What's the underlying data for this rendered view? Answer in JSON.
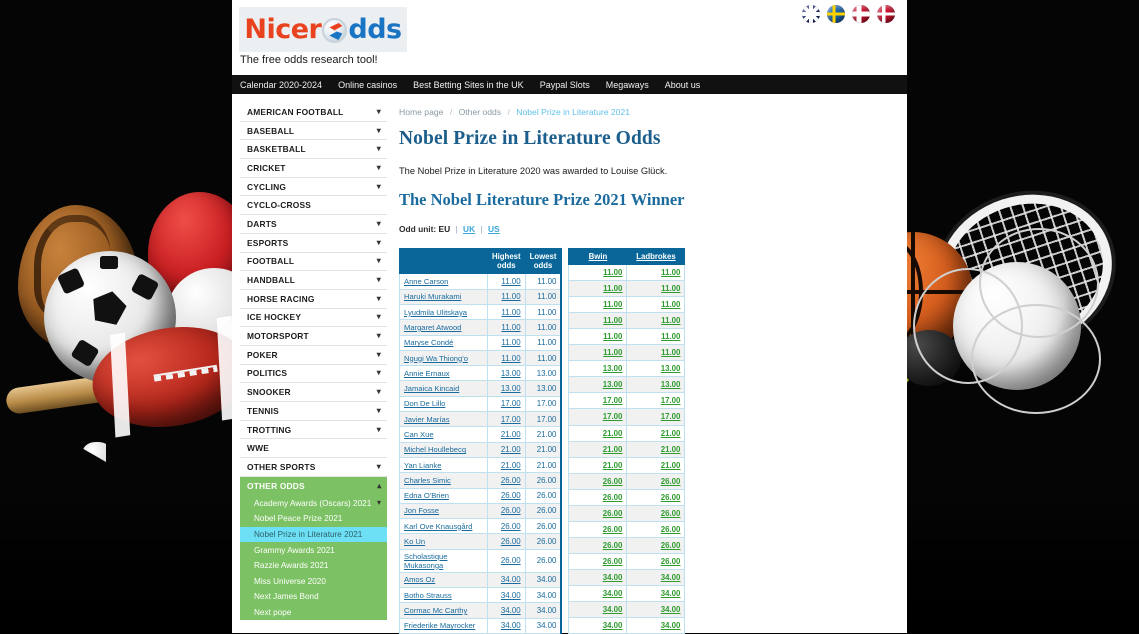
{
  "site": {
    "logo_nicer": "Nicer",
    "logo_dds": "dds",
    "tagline": "The free odds research tool!"
  },
  "flags": [
    {
      "name": "flag-uk",
      "label": "United Kingdom"
    },
    {
      "name": "flag-se",
      "label": "Sweden"
    },
    {
      "name": "flag-no",
      "label": "Norway"
    },
    {
      "name": "flag-dk",
      "label": "Denmark"
    }
  ],
  "topnav": [
    {
      "label": "Calendar 2020-2024"
    },
    {
      "label": "Online casinos"
    },
    {
      "label": "Best Betting Sites in the UK"
    },
    {
      "label": "Paypal Slots"
    },
    {
      "label": "Megaways"
    },
    {
      "label": "About us"
    }
  ],
  "sidebar": {
    "sports": [
      {
        "label": "AMERICAN FOOTBALL",
        "chevron": true
      },
      {
        "label": "BASEBALL",
        "chevron": true
      },
      {
        "label": "BASKETBALL",
        "chevron": true
      },
      {
        "label": "CRICKET",
        "chevron": true
      },
      {
        "label": "CYCLING",
        "chevron": true
      },
      {
        "label": "CYCLO-CROSS",
        "chevron": false
      },
      {
        "label": "DARTS",
        "chevron": true
      },
      {
        "label": "ESPORTS",
        "chevron": true
      },
      {
        "label": "FOOTBALL",
        "chevron": true
      },
      {
        "label": "HANDBALL",
        "chevron": true
      },
      {
        "label": "HORSE RACING",
        "chevron": true
      },
      {
        "label": "ICE HOCKEY",
        "chevron": true
      },
      {
        "label": "MOTORSPORT",
        "chevron": true
      },
      {
        "label": "POKER",
        "chevron": true
      },
      {
        "label": "POLITICS",
        "chevron": true
      },
      {
        "label": "SNOOKER",
        "chevron": true
      },
      {
        "label": "TENNIS",
        "chevron": true
      },
      {
        "label": "TROTTING",
        "chevron": true
      },
      {
        "label": "WWE",
        "chevron": false
      },
      {
        "label": "OTHER SPORTS",
        "chevron": true
      }
    ],
    "other_odds": {
      "header": "OTHER ODDS",
      "expanded": true,
      "items": [
        {
          "label": "Academy Awards (Oscars) 2021",
          "chevron": true,
          "active": false
        },
        {
          "label": "Nobel Peace Prize 2021",
          "chevron": false,
          "active": false
        },
        {
          "label": "Nobel Prize in Literature 2021",
          "chevron": false,
          "active": true
        },
        {
          "label": "Grammy Awards 2021",
          "chevron": false,
          "active": false
        },
        {
          "label": "Razzie Awards 2021",
          "chevron": false,
          "active": false
        },
        {
          "label": "Miss Universe 2020",
          "chevron": false,
          "active": false
        },
        {
          "label": "Next James Bond",
          "chevron": false,
          "active": false
        },
        {
          "label": "Next pope",
          "chevron": false,
          "active": false
        }
      ]
    },
    "colors": {
      "green": "#7cc163",
      "active_highlight": "#6de0f5"
    }
  },
  "content": {
    "breadcrumb": [
      {
        "label": "Home page",
        "current": false
      },
      {
        "label": "Other odds",
        "current": false
      },
      {
        "label": "Nobel Prize in Literature 2021",
        "current": true
      }
    ],
    "breadcrumb_separator": "/",
    "page_title": "Nobel Prize in Literature Odds",
    "intro_text": "The Nobel Prize in Literature 2020 was awarded to Louise Glück.",
    "section_title": "The Nobel Literature Prize 2021 Winner",
    "odd_unit": {
      "label": "Odd unit:",
      "current": "EU",
      "options": [
        "EU",
        "UK",
        "US"
      ],
      "links": [
        "UK",
        "US"
      ],
      "separator": "|"
    },
    "table": {
      "headers": {
        "name": "",
        "highest": "Highest odds",
        "lowest": "Lowest odds"
      },
      "bookmakers": [
        "Bwin",
        "Ladbrokes"
      ],
      "rows": [
        {
          "name": "Anne Carson",
          "highest": "11.00",
          "lowest": "11.00",
          "bwin": "11.00",
          "ladbrokes": "11.00"
        },
        {
          "name": "Haruki Murakami",
          "highest": "11.00",
          "lowest": "11.00",
          "bwin": "11.00",
          "ladbrokes": "11.00"
        },
        {
          "name": "Lyudmila Ulitskaya",
          "highest": "11.00",
          "lowest": "11.00",
          "bwin": "11.00",
          "ladbrokes": "11.00"
        },
        {
          "name": "Margaret Atwood",
          "highest": "11.00",
          "lowest": "11.00",
          "bwin": "11.00",
          "ladbrokes": "11.00"
        },
        {
          "name": "Maryse Condé",
          "highest": "11.00",
          "lowest": "11.00",
          "bwin": "11.00",
          "ladbrokes": "11.00"
        },
        {
          "name": "Ngugi Wa Thiong'o",
          "highest": "11.00",
          "lowest": "11.00",
          "bwin": "11.00",
          "ladbrokes": "11.00"
        },
        {
          "name": "Annie Ernaux",
          "highest": "13.00",
          "lowest": "13.00",
          "bwin": "13.00",
          "ladbrokes": "13.00"
        },
        {
          "name": "Jamaica Kincaid",
          "highest": "13.00",
          "lowest": "13.00",
          "bwin": "13.00",
          "ladbrokes": "13.00"
        },
        {
          "name": "Don De Lillo",
          "highest": "17.00",
          "lowest": "17.00",
          "bwin": "17.00",
          "ladbrokes": "17.00"
        },
        {
          "name": "Javier Marías",
          "highest": "17.00",
          "lowest": "17.00",
          "bwin": "17.00",
          "ladbrokes": "17.00"
        },
        {
          "name": "Can Xue",
          "highest": "21.00",
          "lowest": "21.00",
          "bwin": "21.00",
          "ladbrokes": "21.00"
        },
        {
          "name": "Michel Houllebecq",
          "highest": "21.00",
          "lowest": "21.00",
          "bwin": "21.00",
          "ladbrokes": "21.00"
        },
        {
          "name": "Yan Lianke",
          "highest": "21.00",
          "lowest": "21.00",
          "bwin": "21.00",
          "ladbrokes": "21.00"
        },
        {
          "name": "Charles Simic",
          "highest": "26.00",
          "lowest": "26.00",
          "bwin": "26.00",
          "ladbrokes": "26.00"
        },
        {
          "name": "Edna O'Brien",
          "highest": "26.00",
          "lowest": "26.00",
          "bwin": "26.00",
          "ladbrokes": "26.00"
        },
        {
          "name": "Jon Fosse",
          "highest": "26.00",
          "lowest": "26.00",
          "bwin": "26.00",
          "ladbrokes": "26.00"
        },
        {
          "name": "Karl Ove Knausgård",
          "highest": "26.00",
          "lowest": "26.00",
          "bwin": "26.00",
          "ladbrokes": "26.00"
        },
        {
          "name": "Ko Un",
          "highest": "26.00",
          "lowest": "26.00",
          "bwin": "26.00",
          "ladbrokes": "26.00"
        },
        {
          "name": "Scholastique Mukasonga",
          "highest": "26.00",
          "lowest": "26.00",
          "bwin": "26.00",
          "ladbrokes": "26.00"
        },
        {
          "name": "Amos Oz",
          "highest": "34.00",
          "lowest": "34.00",
          "bwin": "34.00",
          "ladbrokes": "34.00"
        },
        {
          "name": "Botho Strauss",
          "highest": "34.00",
          "lowest": "34.00",
          "bwin": "34.00",
          "ladbrokes": "34.00"
        },
        {
          "name": "Cormac Mc Carthy",
          "highest": "34.00",
          "lowest": "34.00",
          "bwin": "34.00",
          "ladbrokes": "34.00"
        },
        {
          "name": "Friederike Mayrocker",
          "highest": "34.00",
          "lowest": "34.00",
          "bwin": "34.00",
          "ladbrokes": "34.00"
        }
      ]
    },
    "colors": {
      "table_header": "#0a6699",
      "link_blue": "#1a6c9e",
      "odds_green": "#2e9b2e",
      "title_blue": "#1b5e8c"
    }
  }
}
